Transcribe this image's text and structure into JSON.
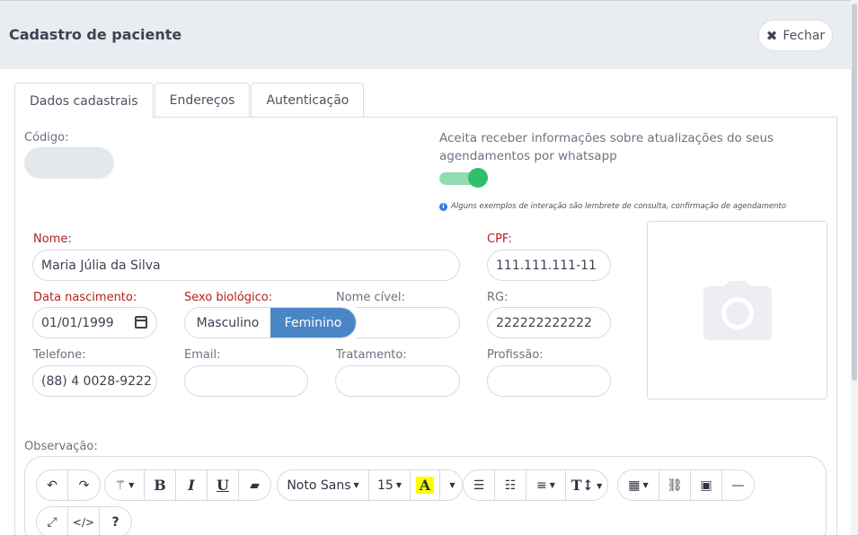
{
  "header": {
    "title": "Cadastro de paciente",
    "close_label": "Fechar"
  },
  "tabs": [
    {
      "label": "Dados cadastrais",
      "active": true
    },
    {
      "label": "Endereços",
      "active": false
    },
    {
      "label": "Autenticação",
      "active": false
    }
  ],
  "form": {
    "codigo_label": "Código:",
    "whatsapp_label": "Aceita receber informações sobre atualizações do seus agendamentos por whatsapp",
    "whatsapp_enabled": true,
    "whatsapp_hint": "Alguns exemplos de interação são lembrete de consulta, confirmação de agendamento",
    "nome_label": "Nome:",
    "nome_value": "Maria Júlia da Silva",
    "cpf_label": "CPF:",
    "cpf_value": "111.111.111-11",
    "nascimento_label": "Data nascimento:",
    "nascimento_value": "01/01/1999",
    "sexo_label": "Sexo biológico:",
    "sexo_options": [
      "Masculino",
      "Feminino"
    ],
    "sexo_selected": "Feminino",
    "nome_civel_label": "Nome cível:",
    "rg_label": "RG:",
    "rg_value": "222222222222",
    "telefone_label": "Telefone:",
    "telefone_value": "(88) 4 0028-9222",
    "email_label": "Email:",
    "tratamento_label": "Tratamento:",
    "profissao_label": "Profissão:",
    "observacao_label": "Observação:"
  },
  "editor": {
    "font_name": "Noto Sans",
    "font_size": "15",
    "icons": [
      "undo-icon",
      "redo-icon",
      "magic-icon",
      "bold-icon",
      "italic-icon",
      "underline-icon",
      "eraser-icon",
      "text-color-icon",
      "bullet-list-icon",
      "numbered-list-icon",
      "align-icon",
      "text-height-icon",
      "table-icon",
      "link-icon",
      "image-icon",
      "horizontal-rule-icon",
      "fullscreen-icon",
      "code-view-icon",
      "help-icon"
    ]
  },
  "colors": {
    "accent": "#4a86c5",
    "required": "#b32020",
    "toggle": "#2fbf6a"
  }
}
